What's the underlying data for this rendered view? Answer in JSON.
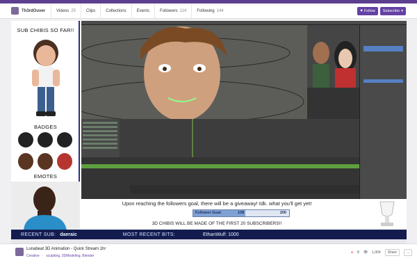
{
  "channel": {
    "name": "Th3rdOuver",
    "tabs": [
      {
        "label": "Videos",
        "count": "25"
      },
      {
        "label": "Clips",
        "count": ""
      },
      {
        "label": "Collections",
        "count": ""
      },
      {
        "label": "Events",
        "count": ""
      },
      {
        "label": "Followers",
        "count": "114"
      },
      {
        "label": "Following",
        "count": "144"
      }
    ],
    "follow_label": "Follow",
    "subscribe_label": "Subscribe"
  },
  "overlay": {
    "sub_chibis_title": "SUB CHIBIS SO FAR!!",
    "badges_label": "BADGES",
    "emotes_label": "EMOTES",
    "giveaway_text": "Upon reaching the followers goal, there will be a giveaway! Idk. what you'll get yet!",
    "goal": {
      "label": "Follower Goal:",
      "current": "108",
      "target": "200",
      "progress": 0.54
    },
    "chibis_text": "3D CHIBIS WILL BE MADE OF THE FIRST 20 SUBSCRIBERS!!",
    "recent_sub_label": "RECENT SUB:",
    "recent_sub_value": "daeraic",
    "recent_bits_label": "MOST RECENT BITS:",
    "recent_bits_value": "EthanWulf: 1000"
  },
  "stream": {
    "title": "Lunabeat 3D Animation - Quick Stream 1hr",
    "category": "Creative",
    "tags": "sculpting, 3DModeling, Blender",
    "viewers": "8",
    "likes": "1,064",
    "share_label": "Share",
    "more_label": "..."
  },
  "colors": {
    "accent": "#6441a4",
    "recentbar": "#141c4f",
    "panel_border": "#2c2c8a"
  }
}
